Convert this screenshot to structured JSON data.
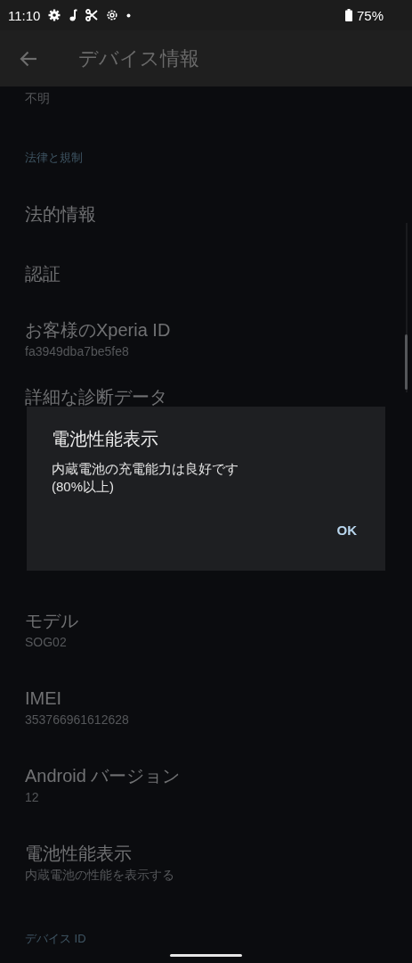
{
  "status_bar": {
    "time": "11:10",
    "battery": "75%"
  },
  "toolbar": {
    "title": "デバイス情報"
  },
  "list": [
    {
      "kind": "subtitle_only",
      "subtitle": "不明"
    },
    {
      "kind": "section",
      "title": "法律と規制"
    },
    {
      "kind": "item",
      "title": "法的情報"
    },
    {
      "kind": "item",
      "title": "認証"
    },
    {
      "kind": "item",
      "title": "お客様のXperia ID",
      "subtitle": "fa3949dba7be5fe8"
    },
    {
      "kind": "covered",
      "title": "詳細な診断データ"
    },
    {
      "kind": "item",
      "title": "モデル",
      "subtitle": "SOG02"
    },
    {
      "kind": "item",
      "title": "IMEI",
      "subtitle": "353766961612628"
    },
    {
      "kind": "item",
      "title": "Android バージョン",
      "subtitle": "12"
    },
    {
      "kind": "item",
      "title": "電池性能表示",
      "subtitle": "内蔵電池の性能を表示する"
    },
    {
      "kind": "section",
      "title": "デバイス ID"
    }
  ],
  "dialog": {
    "title": "電池性能表示",
    "message": "内蔵電池の充電能力は良好です\n(80%以上)",
    "button": "OK"
  }
}
